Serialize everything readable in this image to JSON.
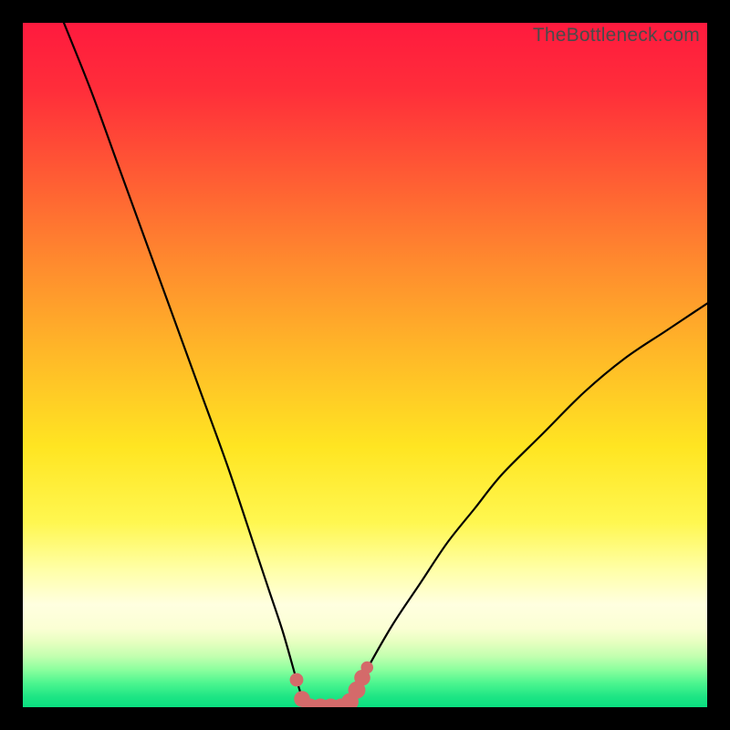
{
  "watermark": "TheBottleneck.com",
  "chart_data": {
    "type": "line",
    "title": "",
    "xlabel": "",
    "ylabel": "",
    "xlim": [
      0,
      100
    ],
    "ylim": [
      0,
      100
    ],
    "series": [
      {
        "name": "bottleneck-curve",
        "x": [
          6,
          10,
          14,
          18,
          22,
          26,
          30,
          34,
          36,
          38,
          40,
          41,
          42,
          44,
          46,
          48,
          50,
          54,
          58,
          62,
          66,
          70,
          76,
          82,
          88,
          94,
          100
        ],
        "y": [
          100,
          90,
          79,
          68,
          57,
          46,
          35,
          23,
          17,
          11,
          4,
          1,
          0,
          0,
          0,
          1,
          5,
          12,
          18,
          24,
          29,
          34,
          40,
          46,
          51,
          55,
          59
        ]
      }
    ],
    "markers": {
      "name": "highlight-dots",
      "color": "#d46a6a",
      "points": [
        {
          "x": 40.0,
          "y": 4.0,
          "r": 1.1
        },
        {
          "x": 40.8,
          "y": 1.2,
          "r": 1.3
        },
        {
          "x": 42.0,
          "y": 0.0,
          "r": 1.4
        },
        {
          "x": 43.5,
          "y": 0.0,
          "r": 1.4
        },
        {
          "x": 45.0,
          "y": 0.0,
          "r": 1.4
        },
        {
          "x": 46.5,
          "y": 0.0,
          "r": 1.4
        },
        {
          "x": 47.8,
          "y": 0.8,
          "r": 1.4
        },
        {
          "x": 48.8,
          "y": 2.5,
          "r": 1.4
        },
        {
          "x": 49.6,
          "y": 4.3,
          "r": 1.3
        },
        {
          "x": 50.3,
          "y": 5.8,
          "r": 1.0
        }
      ]
    },
    "gradient_stops": [
      {
        "offset": 0.0,
        "color": "#ff1a3e"
      },
      {
        "offset": 0.1,
        "color": "#ff2e3a"
      },
      {
        "offset": 0.22,
        "color": "#ff5a34"
      },
      {
        "offset": 0.35,
        "color": "#ff8a2e"
      },
      {
        "offset": 0.48,
        "color": "#ffb728"
      },
      {
        "offset": 0.62,
        "color": "#ffe522"
      },
      {
        "offset": 0.73,
        "color": "#fff750"
      },
      {
        "offset": 0.8,
        "color": "#ffffa8"
      },
      {
        "offset": 0.85,
        "color": "#ffffe0"
      },
      {
        "offset": 0.885,
        "color": "#fbffd4"
      },
      {
        "offset": 0.905,
        "color": "#e6ffc0"
      },
      {
        "offset": 0.925,
        "color": "#c4ffb0"
      },
      {
        "offset": 0.945,
        "color": "#8cff9e"
      },
      {
        "offset": 0.965,
        "color": "#4cf58f"
      },
      {
        "offset": 0.985,
        "color": "#1de584"
      },
      {
        "offset": 1.0,
        "color": "#0adf80"
      }
    ]
  }
}
